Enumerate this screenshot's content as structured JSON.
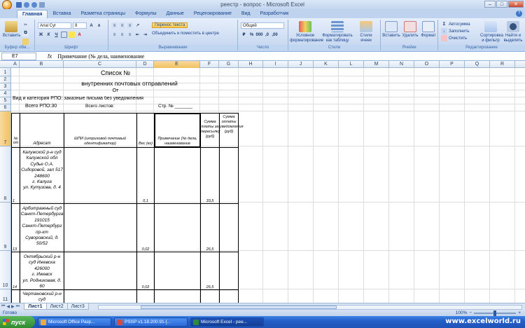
{
  "window": {
    "title": "реестр - вопрос - Microsoft Excel",
    "controls": [
      "–",
      "□",
      "✕"
    ]
  },
  "ribbon_tabs": [
    "Главная",
    "Вставка",
    "Разметка страницы",
    "Формулы",
    "Данные",
    "Рецензирование",
    "Вид",
    "Разработчик"
  ],
  "ribbon": {
    "paste": "Вставить",
    "font_name": "Arial Cyr",
    "font_size": "8",
    "wrap_text": "Перенос текста",
    "merge_center": "Объединить и поместить в центре",
    "number_format": "Общий",
    "conditional": "Условное форматирование",
    "format_table": "Форматировать как таблицу",
    "cell_styles": "Стили ячеек",
    "insert": "Вставить",
    "delete": "Удалить",
    "format": "Формат",
    "autosum": "Автосумма",
    "fill": "Заполнить",
    "clear": "Очистить",
    "sort_filter": "Сортировка и фильтр",
    "find_select": "Найти и выделить",
    "groups": [
      "Буфер обм...",
      "Шрифт",
      "Выравнивание",
      "Число",
      "Стили",
      "Ячейки",
      "Редактирование"
    ]
  },
  "formula_bar": {
    "cell_ref": "E7",
    "fx": "fx",
    "content": "Примечание (№ дела, наименование"
  },
  "columns": [
    "A",
    "B",
    "C",
    "D",
    "E",
    "F",
    "G",
    "H",
    "I",
    "J",
    "K",
    "L",
    "M",
    "N",
    "O",
    "P",
    "Q",
    "R"
  ],
  "rows": [
    "1",
    "2",
    "3",
    "4",
    "5",
    "6",
    "7",
    "8",
    "9",
    "10",
    "11"
  ],
  "sheet": {
    "title1": "Список №",
    "title2": "внутренних почтовых отправлений",
    "from": "От",
    "kind": "Вид и категория РПО: заказные письма без уведомления",
    "total_rpo": "Всего РПО:30",
    "total_sheets": "Всего листов:",
    "page": "Стр. №",
    "h_num": "№ п/п",
    "h_addr": "Адресат",
    "h_barcode": "ШПИ (штриховой почтовый идентификатор)",
    "h_weight": "Вес (кг)",
    "h_note": "Примечание (№ дела, наименование",
    "h_fee": "Сумма платы за пересылку (руб)",
    "h_notify": "Сумма оплаты уведомления (руб)",
    "rows": [
      {
        "num": "1",
        "addr": [
          "Калужской р-н суд",
          "Калужской обл",
          "Судье О.А.",
          "Сидоровой, зал 517",
          "248600",
          "г. Калуга",
          "ул. Кутузова, д. 4"
        ],
        "weight": "0,1",
        "fee": "33,5"
      },
      {
        "num": "13",
        "addr": [
          "Арбитражный суд",
          "Санкт-Петербурга",
          "191015",
          "Санкт-Петербург",
          "пр-кт",
          "Суворовский, д.",
          "50/52"
        ],
        "weight": "0,02",
        "fee": "26,5"
      },
      {
        "num": "14",
        "addr": [
          "Октябрьский р-н",
          "суд Ижевска",
          "426000",
          "г. Ижевск",
          "ул. Родниковая, д.",
          "60"
        ],
        "weight": "0,02",
        "fee": "26,5"
      },
      {
        "num": "",
        "addr": [
          "Чертановский р-н",
          "суд"
        ],
        "weight": "",
        "fee": ""
      }
    ]
  },
  "sheet_tabs": [
    "Лист1",
    "Лист2",
    "Лист3"
  ],
  "status": {
    "ready": "Готово",
    "zoom": "100%"
  },
  "taskbar": {
    "start": "пуск",
    "tasks": [
      "Microsoft Office Разр...",
      "PSSP v1.18.200.91-[...",
      "Microsoft Excel - рее..."
    ],
    "watermark": "www.excelworld.ru"
  }
}
